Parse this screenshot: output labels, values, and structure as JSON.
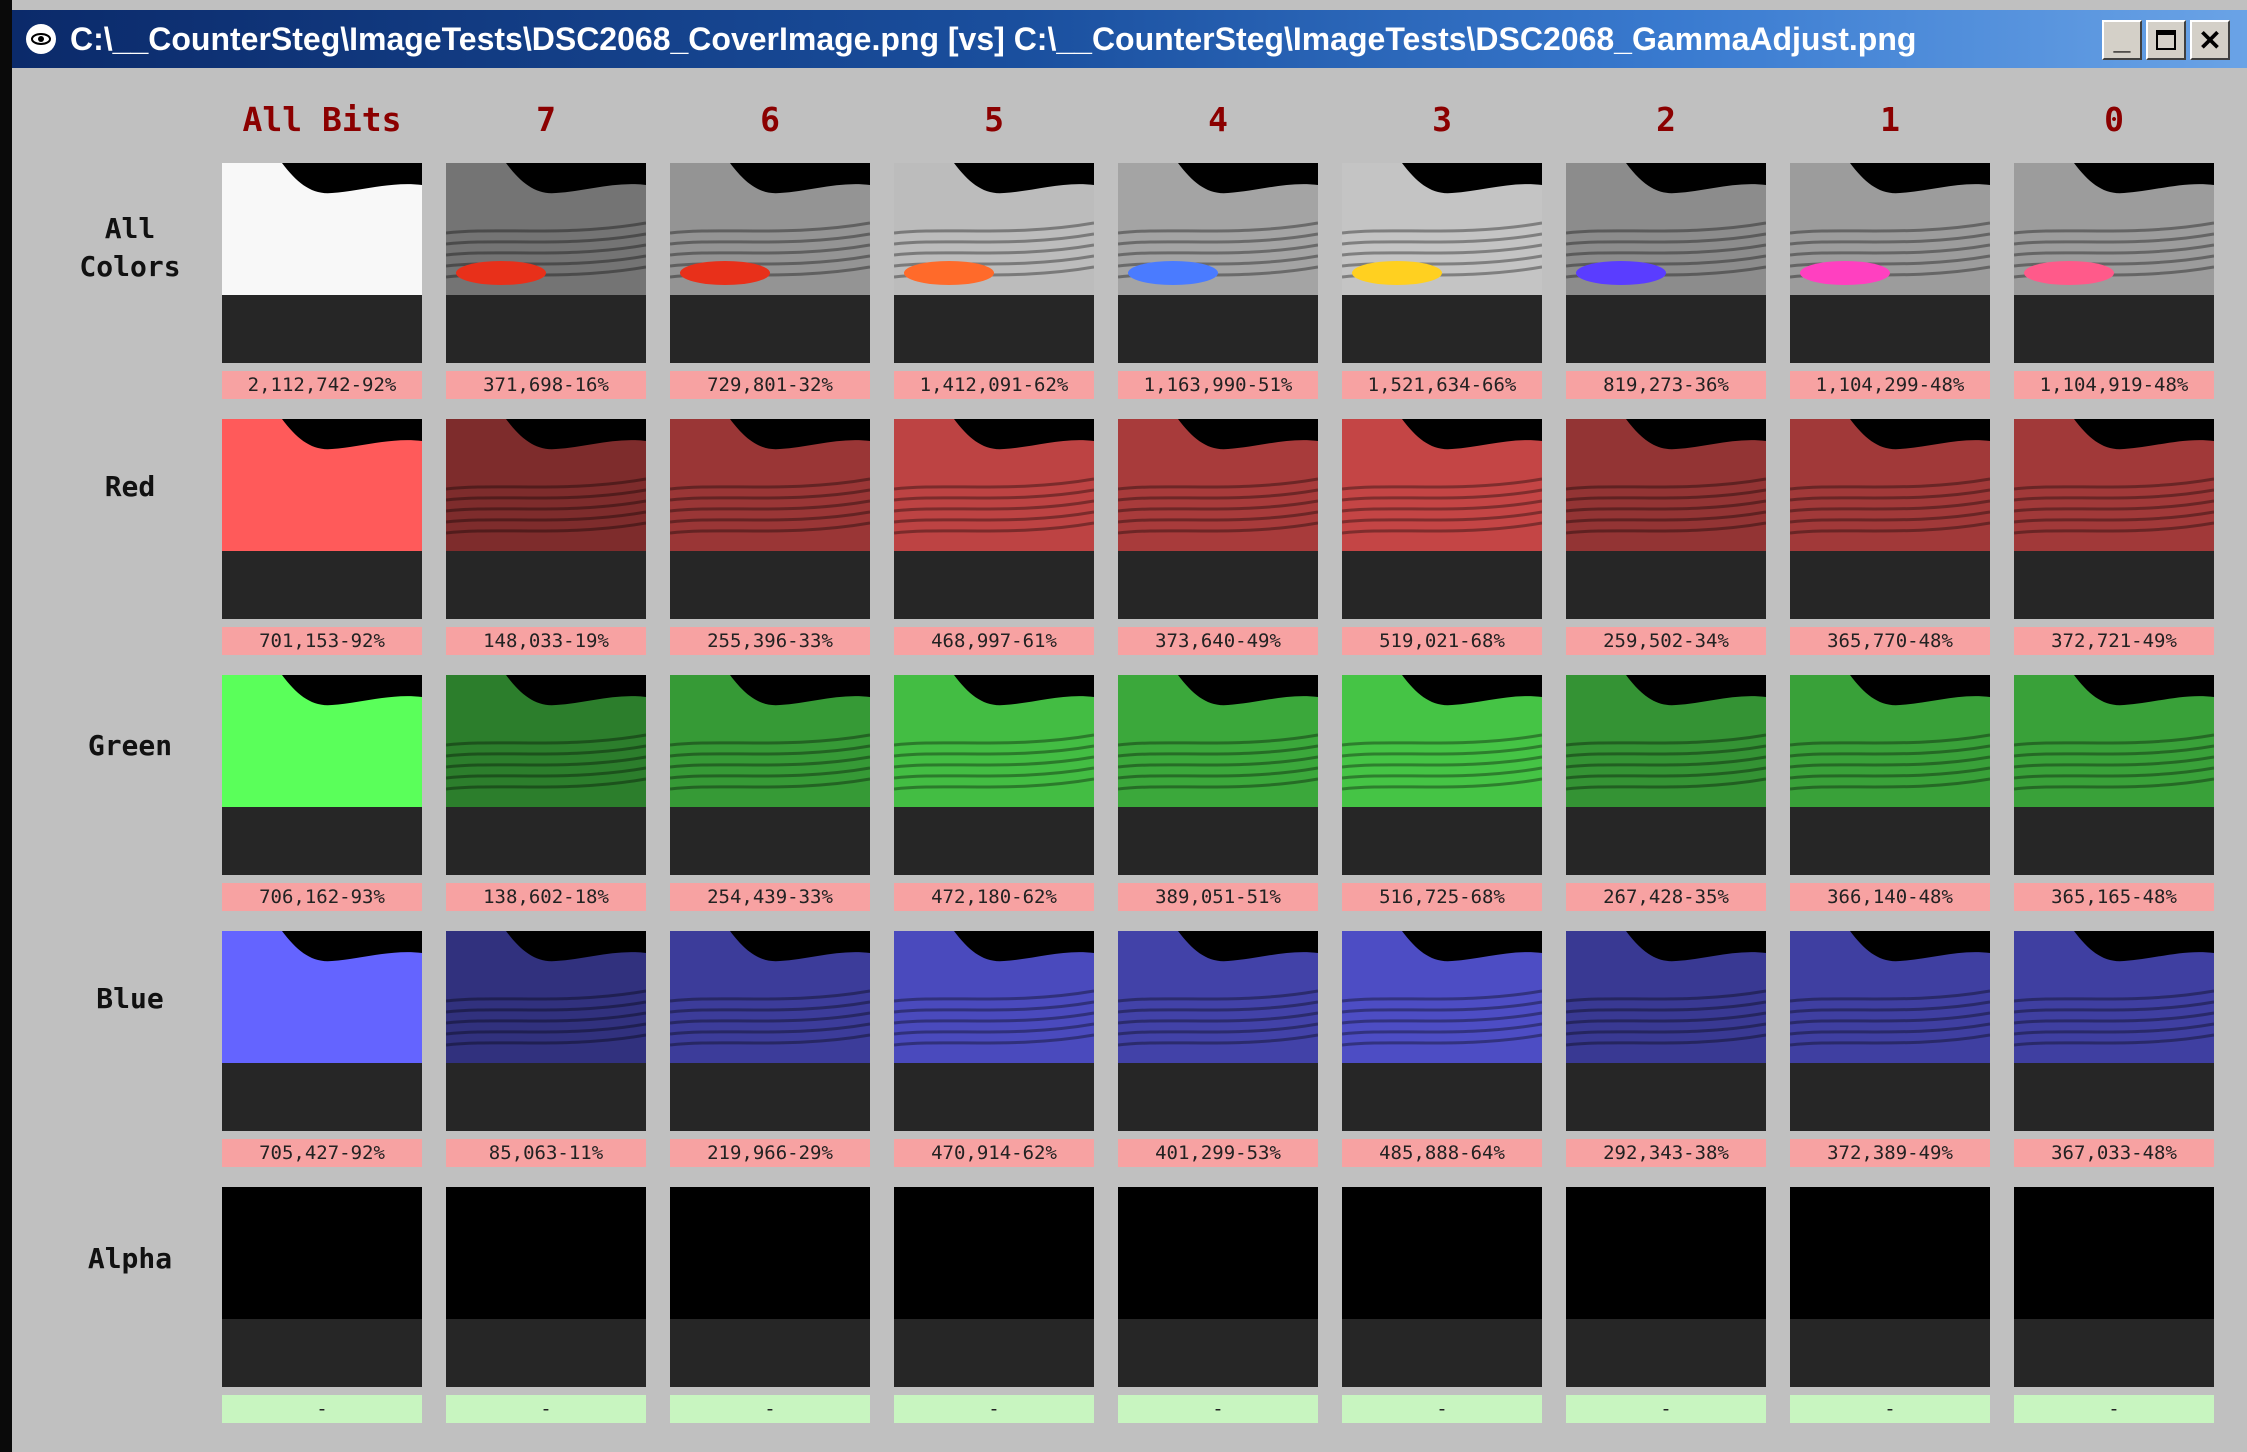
{
  "window": {
    "title": "C:\\__CounterSteg\\ImageTests\\DSC2068_CoverImage.png [vs] C:\\__CounterSteg\\ImageTests\\DSC2068_GammaAdjust.png",
    "minimize_glyph": "_",
    "close_glyph": "✕"
  },
  "columns": [
    "All Bits",
    "7",
    "6",
    "5",
    "4",
    "3",
    "2",
    "1",
    "0"
  ],
  "rows": [
    {
      "label": "All\nColors",
      "stats": [
        "2,112,742-92%",
        "371,698-16%",
        "729,801-32%",
        "1,412,091-62%",
        "1,163,990-51%",
        "1,521,634-66%",
        "819,273-36%",
        "1,104,299-48%",
        "1,104,919-48%"
      ]
    },
    {
      "label": "Red",
      "stats": [
        "701,153-92%",
        "148,033-19%",
        "255,396-33%",
        "468,997-61%",
        "373,640-49%",
        "519,021-68%",
        "259,502-34%",
        "365,770-48%",
        "372,721-49%"
      ]
    },
    {
      "label": "Green",
      "stats": [
        "706,162-93%",
        "138,602-18%",
        "254,439-33%",
        "472,180-62%",
        "389,051-51%",
        "516,725-68%",
        "267,428-35%",
        "366,140-48%",
        "365,165-48%"
      ]
    },
    {
      "label": "Blue",
      "stats": [
        "705,427-92%",
        "85,063-11%",
        "219,966-29%",
        "470,914-62%",
        "401,299-53%",
        "485,888-64%",
        "292,343-38%",
        "372,389-49%",
        "367,033-48%"
      ]
    },
    {
      "label": "Alpha",
      "stats": [
        "-",
        "-",
        "-",
        "-",
        "-",
        "-",
        "-",
        "-",
        "-"
      ]
    }
  ],
  "colors": {
    "header_text": "#8b0000",
    "stat_pink": "#f7a2a2",
    "stat_green": "#c8f5c0",
    "titlebar": "#1a4f9e"
  }
}
